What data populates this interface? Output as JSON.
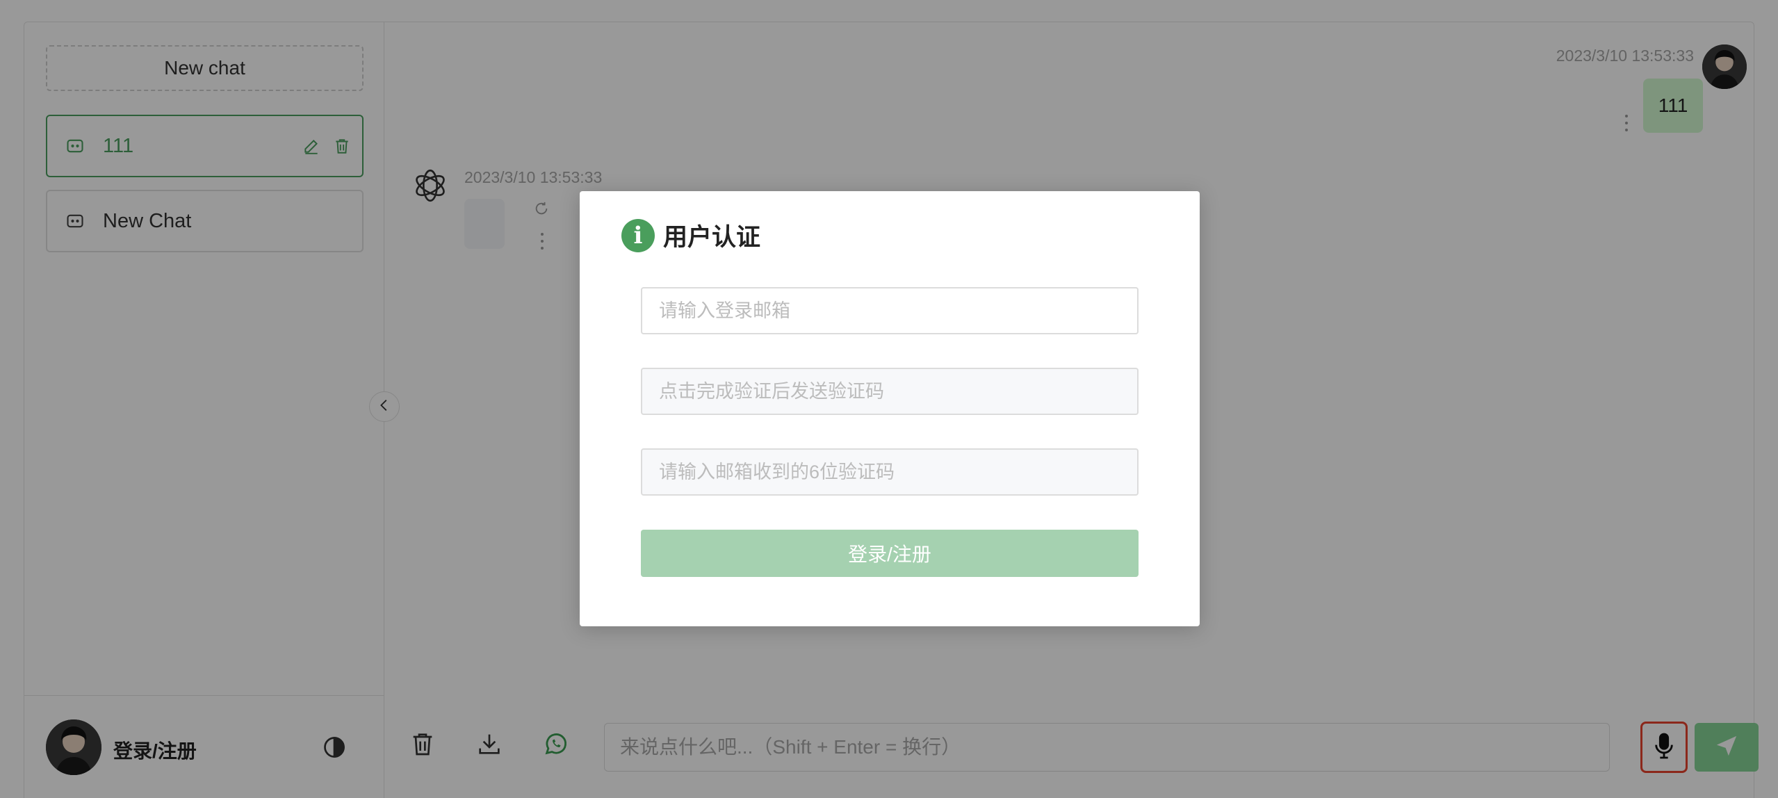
{
  "sidebar": {
    "new_chat_label": "New chat",
    "conversations": [
      {
        "label": "111",
        "active": true
      },
      {
        "label": "New Chat",
        "active": false
      }
    ],
    "footer": {
      "user_name": "登录/注册"
    }
  },
  "chat": {
    "user_message": {
      "time": "2023/3/10 13:53:33",
      "text": "111"
    },
    "ai_message": {
      "time": "2023/3/10 13:53:33",
      "text": ""
    },
    "input_placeholder": "来说点什么吧...（Shift + Enter = 换行）"
  },
  "modal": {
    "title": "用户认证",
    "email_placeholder": "请输入登录邮箱",
    "captcha_placeholder": "点击完成验证后发送验证码",
    "code_placeholder": "请输入邮箱收到的6位验证码",
    "submit_label": "登录/注册"
  },
  "colors": {
    "accent": "#4b9e5f",
    "send_button": "#85d497",
    "mic_highlight": "#e8432e",
    "overlay": "rgba(0,0,0,0.40)"
  },
  "icons": [
    "message-icon",
    "edit-icon",
    "trash-icon",
    "theme-toggle-icon",
    "chevron-left-icon",
    "openai-logo-icon",
    "refresh-icon",
    "more-dots-icon",
    "download-icon",
    "whatsapp-icon",
    "microphone-icon",
    "send-icon",
    "info-icon"
  ]
}
